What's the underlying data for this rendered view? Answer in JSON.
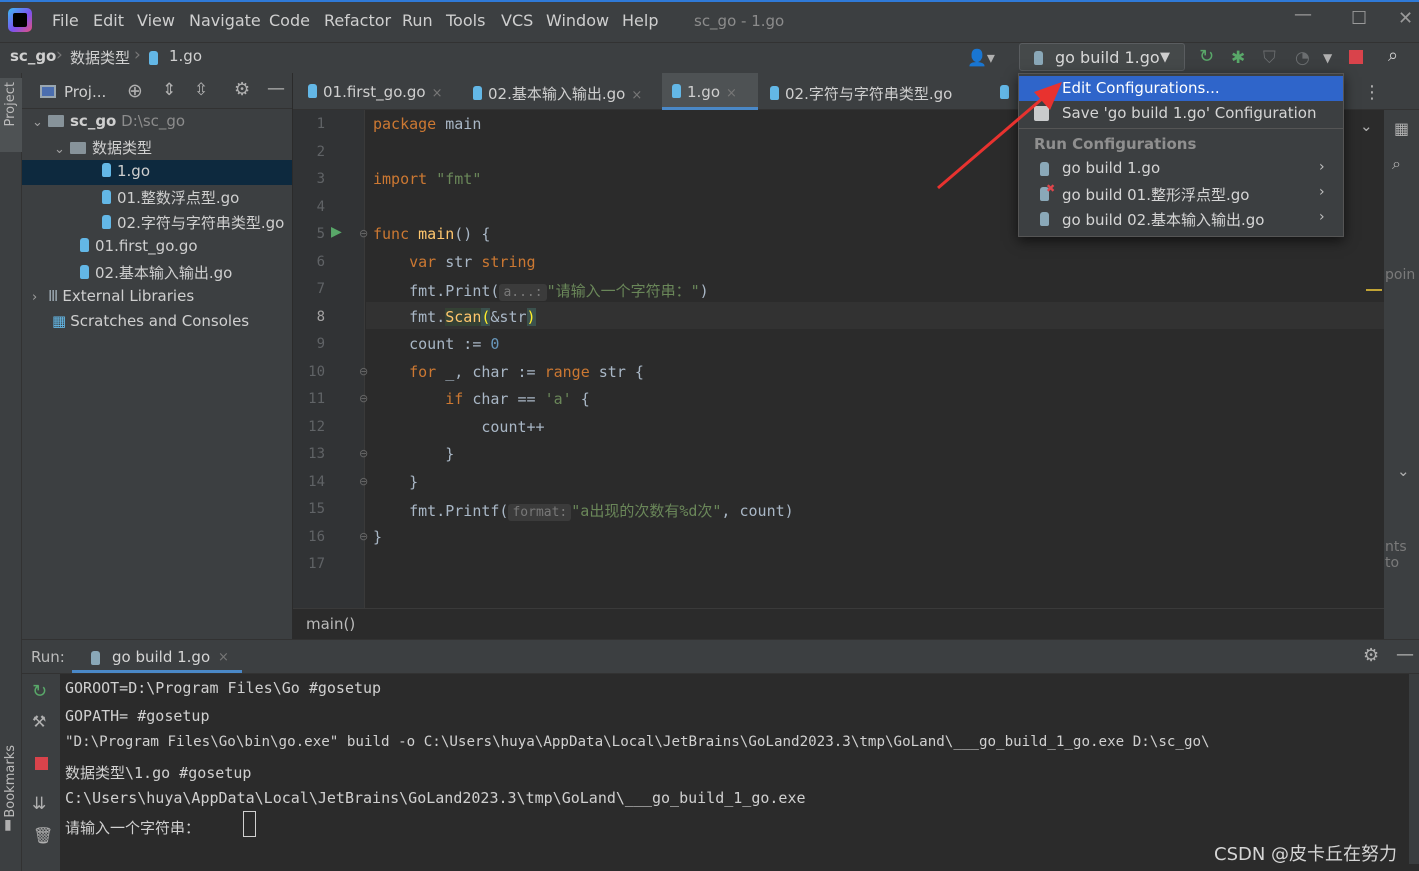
{
  "menubar": {
    "items": [
      "File",
      "Edit",
      "View",
      "Navigate",
      "Code",
      "Refactor",
      "Run",
      "Tools",
      "VCS",
      "Window",
      "Help"
    ],
    "window_title": "sc_go - 1.go"
  },
  "navbar": {
    "breadcrumbs": [
      "sc_go",
      "数据类型",
      "1.go"
    ],
    "run_config": "go build 1.go"
  },
  "left_stripe": {
    "project": "Project",
    "bookmarks": "Bookmarks"
  },
  "project_panel": {
    "title": "Proj...",
    "root_name": "sc_go",
    "root_path": "D:\\sc_go",
    "folder": "数据类型",
    "files_in_folder": [
      "1.go",
      "01.整数浮点型.go",
      "02.字符与字符串类型.go"
    ],
    "root_files": [
      "01.first_go.go",
      "02.基本输入输出.go"
    ],
    "external": "External Libraries",
    "scratches": "Scratches and Consoles"
  },
  "tabs": [
    {
      "label": "01.first_go.go",
      "close": "×"
    },
    {
      "label": "02.基本输入输出.go",
      "close": "×"
    },
    {
      "label": "1.go",
      "close": "×"
    },
    {
      "label": "02.字符与字符串类型.go",
      "close": ""
    }
  ],
  "editor": {
    "line_numbers": [
      "1",
      "2",
      "3",
      "4",
      "5",
      "6",
      "7",
      "8",
      "9",
      "10",
      "11",
      "12",
      "13",
      "14",
      "15",
      "16",
      "17"
    ],
    "code": {
      "l1_kw": "package",
      "l1_rest": " main",
      "l3_kw": "import",
      "l3_str": " \"fmt\"",
      "l5_kw": "func",
      "l5_fn": " main",
      "l5_rest": "() {",
      "l6_kw": "    var",
      "l6_mid": " str ",
      "l6_type": "string",
      "l7_a": "    fmt.Print(",
      "l7_hint": "a...:",
      "l7_str": "\"请输入一个字符串：\"",
      "l7_b": ")",
      "l8_a": "    fmt.",
      "l8_fn": "Scan",
      "l8_p1": "(",
      "l8_mid": "&str",
      "l8_p2": ")",
      "l9_a": "    count := ",
      "l9_num": "0",
      "l10_kw": "    for",
      "l10_mid": " _, char := ",
      "l10_kw2": "range",
      "l10_rest": " str {",
      "l11_kw": "        if",
      "l11_mid": " char == ",
      "l11_str": "'a'",
      "l11_rest": " {",
      "l12": "            count++",
      "l13": "        }",
      "l14": "    }",
      "l15_a": "    fmt.Printf(",
      "l15_hint": "format:",
      "l15_str": "\"a出现的次数有%d次\"",
      "l15_b": ", count)",
      "l16": "}"
    },
    "breadcrumb": "main()",
    "right_hint1": "poin",
    "right_hint2": "nts to"
  },
  "popup": {
    "edit": "Edit Configurations...",
    "save": "Save 'go build 1.go' Configuration",
    "section": "Run Configurations",
    "configs": [
      "go build 1.go",
      "go build 01.整形浮点型.go",
      "go build 02.基本输入输出.go"
    ]
  },
  "run_panel": {
    "label": "Run:",
    "tab": "go build 1.go",
    "tab_close": "×",
    "console": [
      "GOROOT=D:\\Program Files\\Go #gosetup",
      "GOPATH= #gosetup",
      "\"D:\\Program Files\\Go\\bin\\go.exe\" build -o C:\\Users\\huya\\AppData\\Local\\JetBrains\\GoLand2023.3\\tmp\\GoLand\\___go_build_1_go.exe D:\\sc_go\\",
      "数据类型\\1.go #gosetup",
      "C:\\Users\\huya\\AppData\\Local\\JetBrains\\GoLand2023.3\\tmp\\GoLand\\___go_build_1_go.exe",
      "请输入一个字符串："
    ]
  },
  "watermark": "CSDN @皮卡丘在努力",
  "colors": {
    "accent": "#2f65ca",
    "keyword": "#cc7832",
    "string": "#6a8759",
    "function": "#ffc66d",
    "number": "#6897bb",
    "arrow": "#e8322f"
  }
}
